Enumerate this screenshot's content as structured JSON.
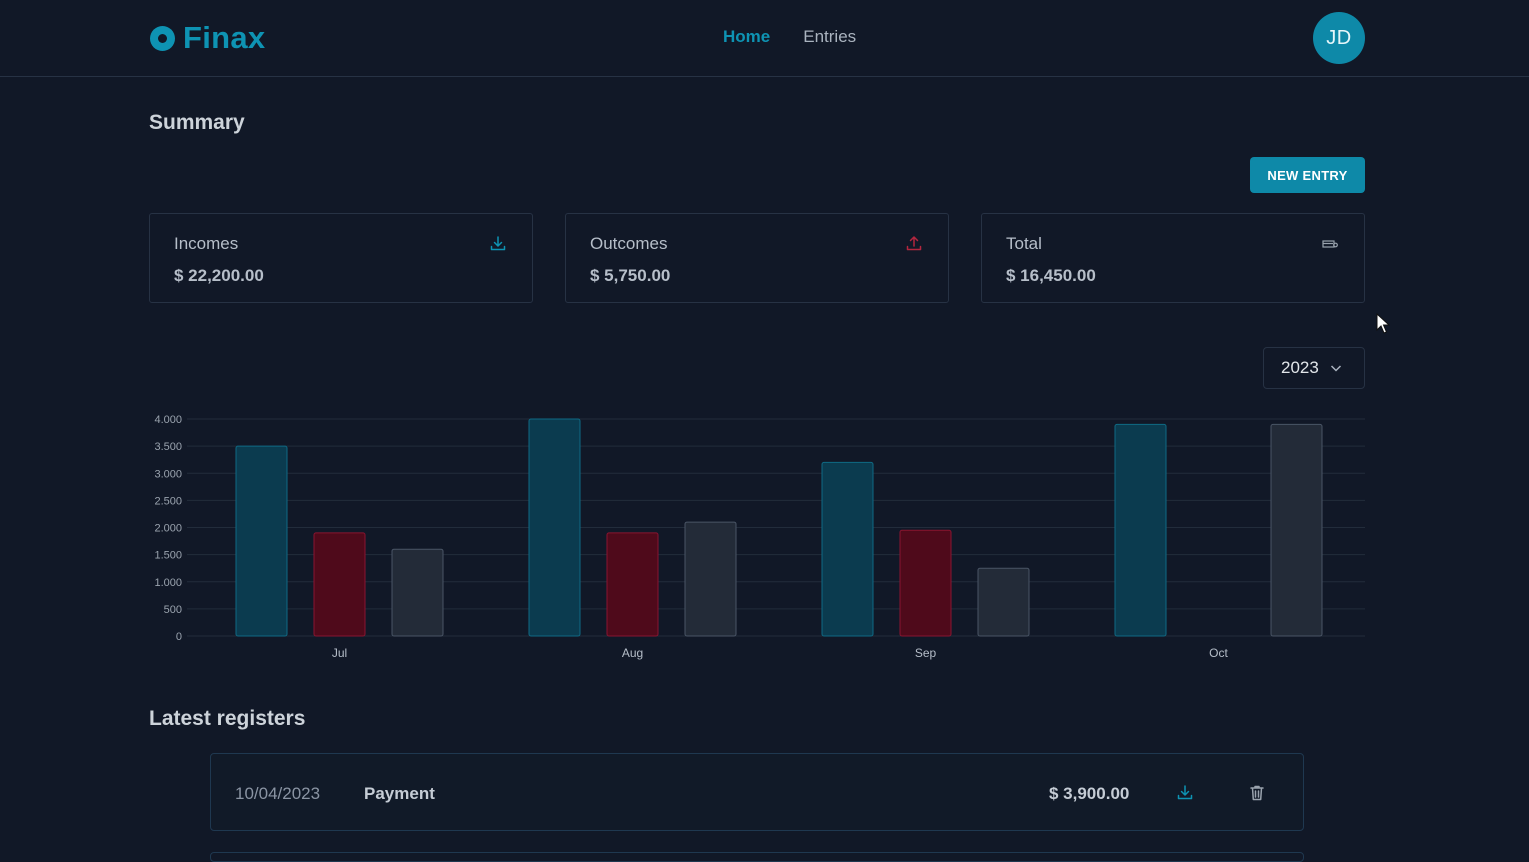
{
  "app": {
    "name": "Finax",
    "avatar_initials": "JD"
  },
  "nav": [
    {
      "label": "Home",
      "active": true
    },
    {
      "label": "Entries",
      "active": false
    }
  ],
  "summary": {
    "title": "Summary",
    "new_entry_label": "NEW ENTRY",
    "cards": [
      {
        "label": "Incomes",
        "value": "$ 22,200.00",
        "icon": "download-icon",
        "color": "#0e93b3"
      },
      {
        "label": "Outcomes",
        "value": "$ 5,750.00",
        "icon": "upload-icon",
        "color": "#b3263f"
      },
      {
        "label": "Total",
        "value": "$ 16,450.00",
        "icon": "wallet-icon",
        "color": "#9aa3ae"
      }
    ]
  },
  "year_select": {
    "value": "2023"
  },
  "chart_data": {
    "type": "bar",
    "categories": [
      "Jul",
      "Aug",
      "Sep",
      "Oct"
    ],
    "series": [
      {
        "values": [
          3500,
          4000,
          3200,
          3900
        ],
        "color": "#0b3b4f",
        "stroke": "#0f6a84"
      },
      {
        "values": [
          1900,
          1900,
          1950,
          0
        ],
        "color": "#4f0a1b",
        "stroke": "#8a1430"
      },
      {
        "values": [
          1600,
          2100,
          1250,
          3900
        ],
        "color": "#232b38",
        "stroke": "#4a5566"
      }
    ],
    "yticks": [
      "0",
      "500",
      "1.000",
      "1.500",
      "2.000",
      "2.500",
      "3.000",
      "3.500",
      "4.000"
    ],
    "ylim": [
      0,
      4000
    ],
    "grid": true
  },
  "registers": {
    "title": "Latest registers",
    "rows": [
      {
        "date": "10/04/2023",
        "description": "Payment",
        "amount": "$ 3,900.00"
      }
    ]
  }
}
